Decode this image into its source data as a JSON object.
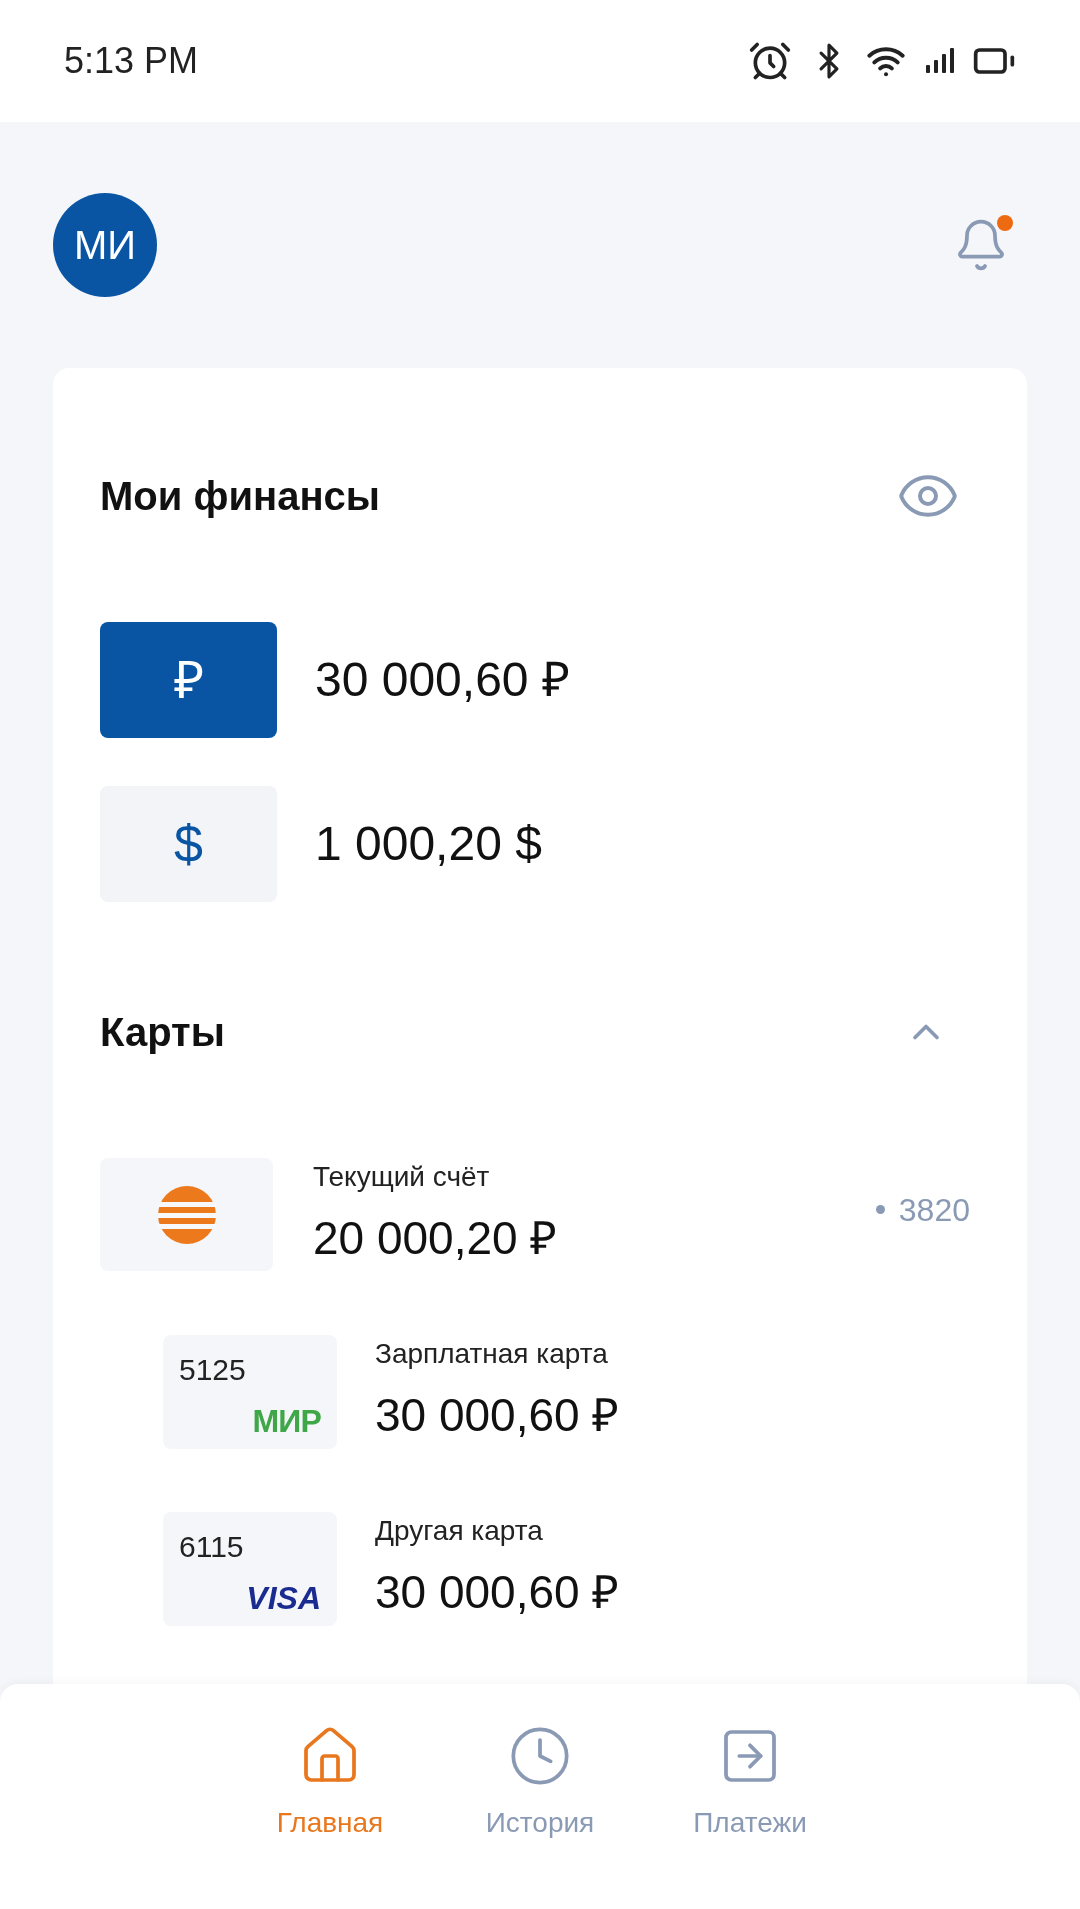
{
  "status_bar": {
    "time": "5:13 PM"
  },
  "header": {
    "avatar_initials": "МИ",
    "has_notification": true
  },
  "finances": {
    "title": "Мои финансы",
    "balances": [
      {
        "symbol": "₽",
        "amount": "30 000,60 ₽",
        "selected": true
      },
      {
        "symbol": "$",
        "amount": "1 000,20 $",
        "selected": false
      }
    ]
  },
  "cards_section": {
    "title": "Карты",
    "expanded": true,
    "account": {
      "title": "Текущий счёт",
      "amount": "20 000,20 ₽",
      "number": "3820"
    },
    "cards": [
      {
        "last_digits": "5125",
        "kind": "mir",
        "payment_system": "МИР",
        "title": "Зарплатная карта",
        "amount": "30 000,60 ₽"
      },
      {
        "last_digits": "6115",
        "kind": "visa",
        "payment_system": "VISA",
        "title": "Другая карта",
        "amount": "30 000,60 ₽"
      }
    ]
  },
  "nav": [
    {
      "label": "Главная",
      "kind": "home",
      "selected": true
    },
    {
      "label": "История",
      "kind": "history",
      "selected": false
    },
    {
      "label": "Платежи",
      "kind": "payments",
      "selected": false
    }
  ]
}
